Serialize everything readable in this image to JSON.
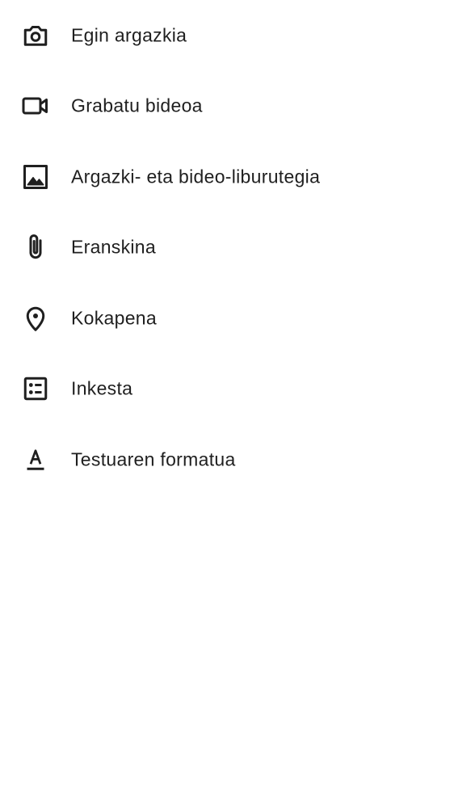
{
  "menu": {
    "items": [
      {
        "icon": "camera-icon",
        "label": "Egin argazkia"
      },
      {
        "icon": "videocam-icon",
        "label": "Grabatu bideoa"
      },
      {
        "icon": "image-icon",
        "label": "Argazki- eta bideo-liburutegia"
      },
      {
        "icon": "attachment-icon",
        "label": "Eranskina"
      },
      {
        "icon": "location-pin-icon",
        "label": "Kokapena"
      },
      {
        "icon": "poll-icon",
        "label": "Inkesta"
      },
      {
        "icon": "text-format-icon",
        "label": "Testuaren formatua"
      }
    ]
  },
  "colors": {
    "text": "#1f1f1f",
    "icon": "#1f1f1f",
    "background": "#ffffff"
  }
}
